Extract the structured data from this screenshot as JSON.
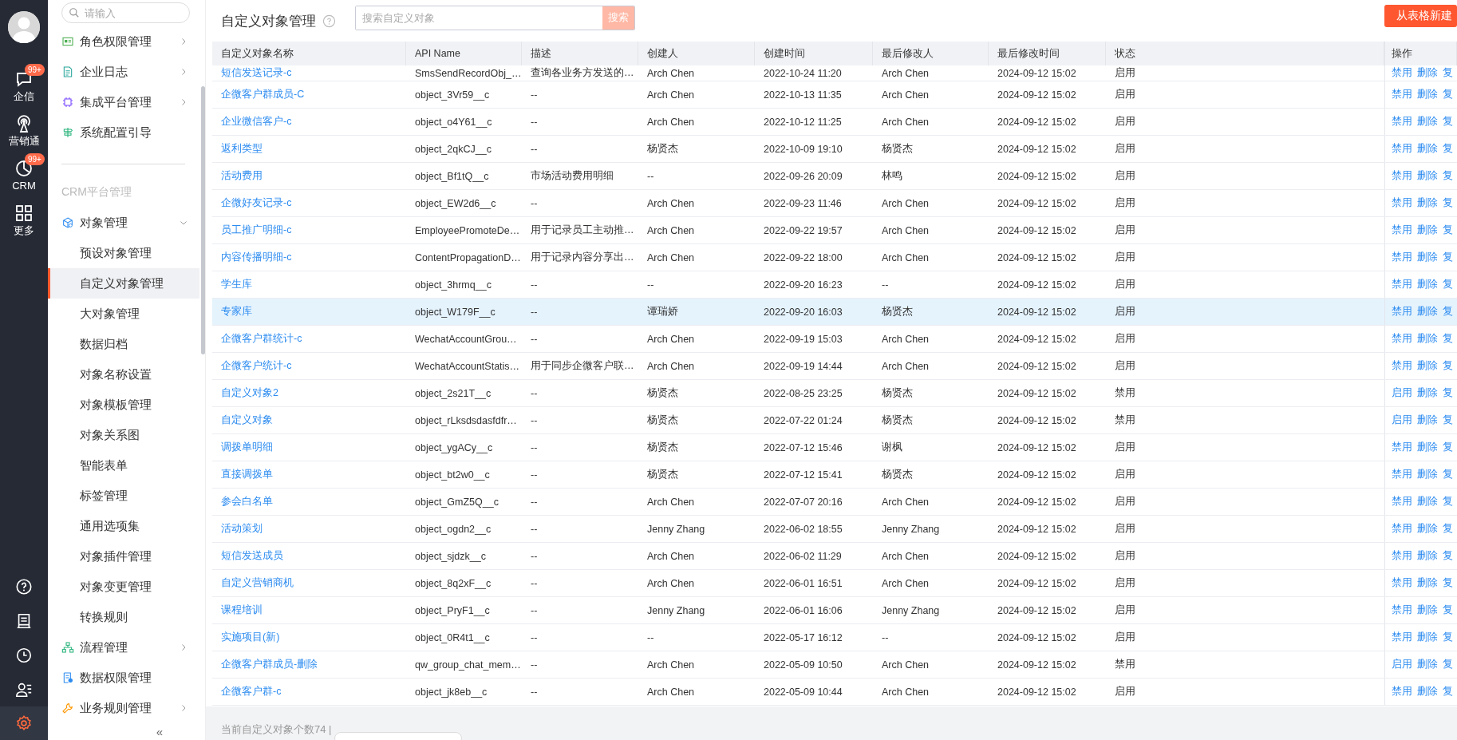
{
  "nav": {
    "items": [
      {
        "label": "企信",
        "badge": "99+"
      },
      {
        "label": "营销通"
      },
      {
        "label": "CRM",
        "badge": "99+"
      },
      {
        "label": "更多"
      }
    ],
    "tools": [
      {
        "selected": false
      },
      {
        "selected": false
      },
      {
        "selected": false
      },
      {
        "selected": false
      },
      {
        "selected": true
      }
    ]
  },
  "sidebar": {
    "search": {
      "placeholder": "请输入"
    },
    "items": [
      {
        "kind": "group",
        "label": "角色权限管理",
        "expanded": false
      },
      {
        "kind": "group",
        "label": "企业日志",
        "expanded": false
      },
      {
        "kind": "group",
        "label": "集成平台管理",
        "expanded": false
      },
      {
        "kind": "group",
        "label": "系统配置引导"
      },
      {
        "kind": "section",
        "label": "CRM平台管理"
      },
      {
        "kind": "group",
        "label": "对象管理",
        "expanded": true,
        "children": [
          {
            "label": "预设对象管理",
            "selected": false
          },
          {
            "label": "自定义对象管理",
            "selected": true
          },
          {
            "label": "大对象管理",
            "selected": false
          },
          {
            "label": "数据归档",
            "selected": false
          },
          {
            "label": "对象名称设置",
            "selected": false
          },
          {
            "label": "对象模板管理",
            "selected": false
          },
          {
            "label": "对象关系图",
            "selected": false
          },
          {
            "label": "智能表单",
            "selected": false
          },
          {
            "label": "标签管理",
            "selected": false
          },
          {
            "label": "通用选项集",
            "selected": false
          },
          {
            "label": "对象插件管理",
            "selected": false
          },
          {
            "label": "对象变更管理",
            "selected": false
          },
          {
            "label": "转换规则",
            "selected": false
          }
        ]
      },
      {
        "kind": "group",
        "label": "流程管理",
        "expanded": false
      },
      {
        "kind": "group",
        "label": "数据权限管理"
      },
      {
        "kind": "group",
        "label": "业务规则管理",
        "expanded": false
      }
    ],
    "collapse": "«"
  },
  "header": {
    "title": "自定义对象管理",
    "search": {
      "placeholder": "搜索自定义对象",
      "button": "搜索"
    },
    "new_button": "从表格新建"
  },
  "table": {
    "columns": [
      "自定义对象名称",
      "API Name",
      "描述",
      "创建人",
      "创建时间",
      "最后修改人",
      "最后修改时间",
      "状态",
      "操作"
    ],
    "rows": [
      {
        "selected": false,
        "cells": [
          "短信发送记录-c",
          "SmsSendRecordObj_…",
          "查询各业务方发送的…",
          "Arch Chen",
          "2022-10-24 11:20",
          "Arch Chen",
          "2024-09-12 15:02",
          "启用"
        ],
        "actions": [
          "禁用",
          "删除",
          "复"
        ]
      },
      {
        "selected": false,
        "cells": [
          "企微客户群成员-C",
          "object_3Vr59__c",
          "--",
          "Arch Chen",
          "2022-10-13 11:35",
          "Arch Chen",
          "2024-09-12 15:02",
          "启用"
        ],
        "actions": [
          "禁用",
          "删除",
          "复"
        ]
      },
      {
        "selected": false,
        "cells": [
          "企业微信客户-c",
          "object_o4Y61__c",
          "--",
          "Arch Chen",
          "2022-10-12 11:25",
          "Arch Chen",
          "2024-09-12 15:02",
          "启用"
        ],
        "actions": [
          "禁用",
          "删除",
          "复"
        ]
      },
      {
        "selected": false,
        "cells": [
          "返利类型",
          "object_2qkCJ__c",
          "--",
          "杨贤杰",
          "2022-10-09 19:10",
          "杨贤杰",
          "2024-09-12 15:02",
          "启用"
        ],
        "actions": [
          "禁用",
          "删除",
          "复"
        ]
      },
      {
        "selected": false,
        "cells": [
          "活动费用",
          "object_Bf1tQ__c",
          "市场活动费用明细",
          "--",
          "2022-09-26 20:09",
          "林鸣",
          "2024-09-12 15:02",
          "启用"
        ],
        "actions": [
          "禁用",
          "删除",
          "复"
        ]
      },
      {
        "selected": false,
        "cells": [
          "企微好友记录-c",
          "object_EW2d6__c",
          "--",
          "Arch Chen",
          "2022-09-23 11:46",
          "Arch Chen",
          "2024-09-12 15:02",
          "启用"
        ],
        "actions": [
          "禁用",
          "删除",
          "复"
        ]
      },
      {
        "selected": false,
        "cells": [
          "员工推广明细-c",
          "EmployeePromoteDe…",
          "用于记录员工主动推…",
          "Arch Chen",
          "2022-09-22 19:57",
          "Arch Chen",
          "2024-09-12 15:02",
          "启用"
        ],
        "actions": [
          "禁用",
          "删除",
          "复"
        ]
      },
      {
        "selected": false,
        "cells": [
          "内容传播明细-c",
          "ContentPropagationD…",
          "用于记录内容分享出…",
          "Arch Chen",
          "2022-09-22 18:00",
          "Arch Chen",
          "2024-09-12 15:02",
          "启用"
        ],
        "actions": [
          "禁用",
          "删除",
          "复"
        ]
      },
      {
        "selected": false,
        "cells": [
          "学生库",
          "object_3hrmq__c",
          "--",
          "--",
          "2022-09-20 16:23",
          "--",
          "2024-09-12 15:02",
          "启用"
        ],
        "actions": [
          "禁用",
          "删除",
          "复"
        ]
      },
      {
        "selected": true,
        "cells": [
          "专家库",
          "object_W179F__c",
          "--",
          "谭瑞娇",
          "2022-09-20 16:03",
          "杨贤杰",
          "2024-09-12 15:02",
          "启用"
        ],
        "actions": [
          "禁用",
          "删除",
          "复"
        ]
      },
      {
        "selected": false,
        "cells": [
          "企微客户群统计-c",
          "WechatAccountGrou…",
          "--",
          "Arch Chen",
          "2022-09-19 15:03",
          "Arch Chen",
          "2024-09-12 15:02",
          "启用"
        ],
        "actions": [
          "禁用",
          "删除",
          "复"
        ]
      },
      {
        "selected": false,
        "cells": [
          "企微客户统计-c",
          "WechatAccountStatis…",
          "用于同步企微客户联…",
          "Arch Chen",
          "2022-09-19 14:44",
          "Arch Chen",
          "2024-09-12 15:02",
          "启用"
        ],
        "actions": [
          "禁用",
          "删除",
          "复"
        ]
      },
      {
        "selected": false,
        "cells": [
          "自定义对象2",
          "object_2s21T__c",
          "--",
          "杨贤杰",
          "2022-08-25 23:25",
          "杨贤杰",
          "2024-09-12 15:02",
          "禁用"
        ],
        "actions": [
          "启用",
          "删除",
          "复"
        ]
      },
      {
        "selected": false,
        "cells": [
          "自定义对象",
          "object_rLksdsdasfdfr…",
          "--",
          "杨贤杰",
          "2022-07-22 01:24",
          "杨贤杰",
          "2024-09-12 15:02",
          "禁用"
        ],
        "actions": [
          "启用",
          "删除",
          "复"
        ]
      },
      {
        "selected": false,
        "cells": [
          "调拨单明细",
          "object_ygACy__c",
          "--",
          "杨贤杰",
          "2022-07-12 15:46",
          "谢枫",
          "2024-09-12 15:02",
          "启用"
        ],
        "actions": [
          "禁用",
          "删除",
          "复"
        ]
      },
      {
        "selected": false,
        "cells": [
          "直接调拨单",
          "object_bt2w0__c",
          "--",
          "杨贤杰",
          "2022-07-12 15:41",
          "杨贤杰",
          "2024-09-12 15:02",
          "启用"
        ],
        "actions": [
          "禁用",
          "删除",
          "复"
        ]
      },
      {
        "selected": false,
        "cells": [
          "参会白名单",
          "object_GmZ5Q__c",
          "--",
          "Arch Chen",
          "2022-07-07 20:16",
          "Arch Chen",
          "2024-09-12 15:02",
          "启用"
        ],
        "actions": [
          "禁用",
          "删除",
          "复"
        ]
      },
      {
        "selected": false,
        "cells": [
          "活动策划",
          "object_ogdn2__c",
          "--",
          "Jenny Zhang",
          "2022-06-02 18:55",
          "Jenny Zhang",
          "2024-09-12 15:02",
          "启用"
        ],
        "actions": [
          "禁用",
          "删除",
          "复"
        ]
      },
      {
        "selected": false,
        "cells": [
          "短信发送成员",
          "object_sjdzk__c",
          "--",
          "Arch Chen",
          "2022-06-02 11:29",
          "Arch Chen",
          "2024-09-12 15:02",
          "启用"
        ],
        "actions": [
          "禁用",
          "删除",
          "复"
        ]
      },
      {
        "selected": false,
        "cells": [
          "自定义营销商机",
          "object_8q2xF__c",
          "--",
          "Arch Chen",
          "2022-06-01 16:51",
          "Arch Chen",
          "2024-09-12 15:02",
          "启用"
        ],
        "actions": [
          "禁用",
          "删除",
          "复"
        ]
      },
      {
        "selected": false,
        "cells": [
          "课程培训",
          "object_PryF1__c",
          "--",
          "Jenny Zhang",
          "2022-06-01 16:06",
          "Jenny Zhang",
          "2024-09-12 15:02",
          "启用"
        ],
        "actions": [
          "禁用",
          "删除",
          "复"
        ]
      },
      {
        "selected": false,
        "cells": [
          "实施项目(新)",
          "object_0R4t1__c",
          "--",
          "--",
          "2022-05-17 16:12",
          "--",
          "2024-09-12 15:02",
          "启用"
        ],
        "actions": [
          "禁用",
          "删除",
          "复"
        ]
      },
      {
        "selected": false,
        "cells": [
          "企微客户群成员-删除",
          "qw_group_chat_mem…",
          "--",
          "Arch Chen",
          "2022-05-09 10:50",
          "Arch Chen",
          "2024-09-12 15:02",
          "禁用"
        ],
        "actions": [
          "启用",
          "删除",
          "复"
        ]
      },
      {
        "selected": false,
        "cells": [
          "企微客户群-c",
          "object_jk8eb__c",
          "--",
          "Arch Chen",
          "2022-05-09 10:44",
          "Arch Chen",
          "2024-09-12 15:02",
          "启用"
        ],
        "actions": [
          "禁用",
          "删除",
          "复"
        ]
      }
    ]
  },
  "footer": {
    "summary": "当前自定义对象个数74 |"
  }
}
